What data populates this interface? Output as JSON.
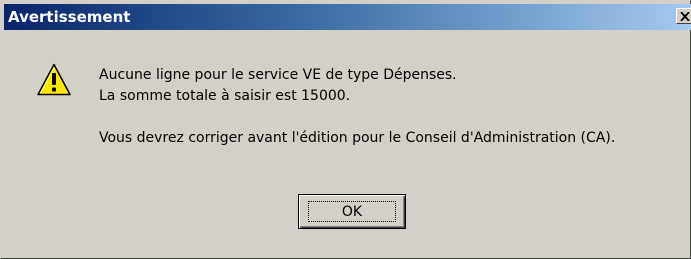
{
  "window": {
    "title": "Avertissement",
    "close_glyph": "✕",
    "close_icon": "close-icon"
  },
  "message": {
    "icon": "warning-icon",
    "line1": "Aucune ligne pour le service VE de type Dépenses.",
    "line2": "La somme totale à saisir est 15000.",
    "line3": "Vous devrez corriger avant l'édition pour le Conseil d'Administration (CA)."
  },
  "buttons": {
    "ok_label": "OK"
  },
  "colors": {
    "title_bar_start": "#0a246a",
    "title_bar_end": "#a6caf0",
    "dialog_background": "#d4d0c8",
    "warning_yellow": "#ffe800"
  }
}
